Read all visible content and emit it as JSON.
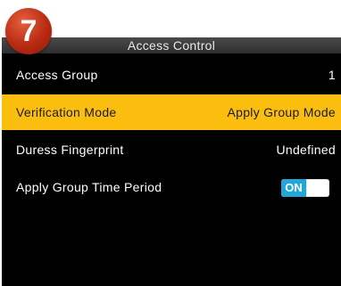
{
  "badge": {
    "number": "7"
  },
  "header": {
    "title": "Access Control"
  },
  "menu": {
    "items": [
      {
        "label": "Access Group",
        "value": "1"
      },
      {
        "label": "Verification Mode",
        "value": "Apply Group Mode"
      },
      {
        "label": "Duress Fingerprint",
        "value": "Undefined"
      },
      {
        "label": "Apply Group Time Period",
        "toggle": "ON"
      }
    ]
  },
  "colors": {
    "selected_row": "#fbbd0e",
    "toggle_on": "#20a7d8",
    "badge": "#c0391b"
  }
}
